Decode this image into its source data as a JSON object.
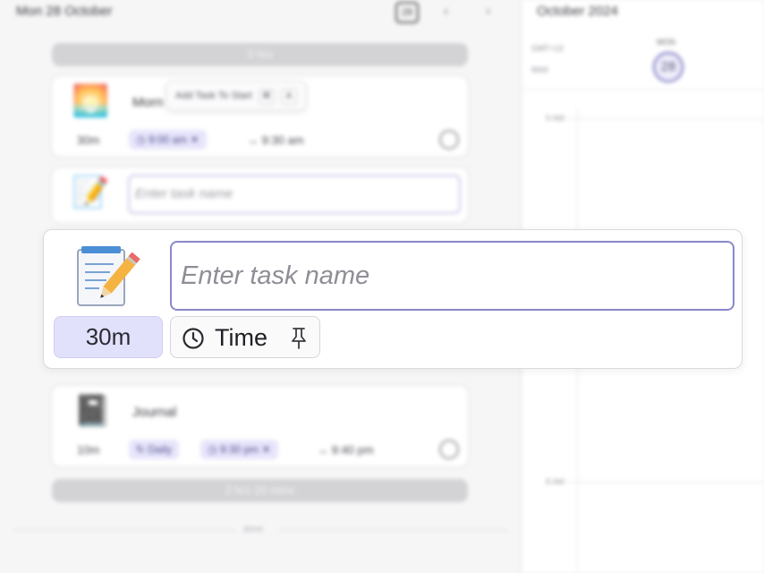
{
  "left_panel": {
    "header_date": "Mon 28 October",
    "today_button": "28",
    "prev_arrow": "‹",
    "next_arrow": "›",
    "gap_top": "3 hrs",
    "gap_bottom": "2 hrs 20 mins",
    "divider_label": "done",
    "tasks": [
      {
        "emoji": "🌅",
        "title": "Morn",
        "duration": "30m",
        "start_chip": "9:00 am",
        "end_time": "→ 9:30 am"
      },
      {
        "emoji": "📓",
        "title": "Journal",
        "duration": "10m",
        "repeat_chip": "Daily",
        "start_chip": "9:30 pm",
        "end_time": "→ 9:40 pm"
      }
    ],
    "tooltip": {
      "text": "Add Task To Start",
      "keys": [
        "⌘",
        "A"
      ]
    },
    "draft_task": {
      "emoji": "📝",
      "placeholder": "Enter task name"
    }
  },
  "calendar": {
    "month_title": "October 2024",
    "timezone_label": "GMT+13",
    "week_label": "W44",
    "day_name": "MON",
    "day_number": "28",
    "hour_labels": [
      "9 AM",
      "8 AM"
    ]
  },
  "new_task": {
    "emoji": "📝",
    "duration": "30m",
    "name_placeholder": "Enter task name",
    "time_button_label": "Time",
    "icons": {
      "task_icon": "memo-icon",
      "time_icon": "clock-icon",
      "pin_icon": "pin-icon"
    }
  },
  "colors": {
    "accent": "#8a88c9",
    "chip_bg": "#e7e5fb",
    "duration_bg": "#e2e1fb"
  }
}
